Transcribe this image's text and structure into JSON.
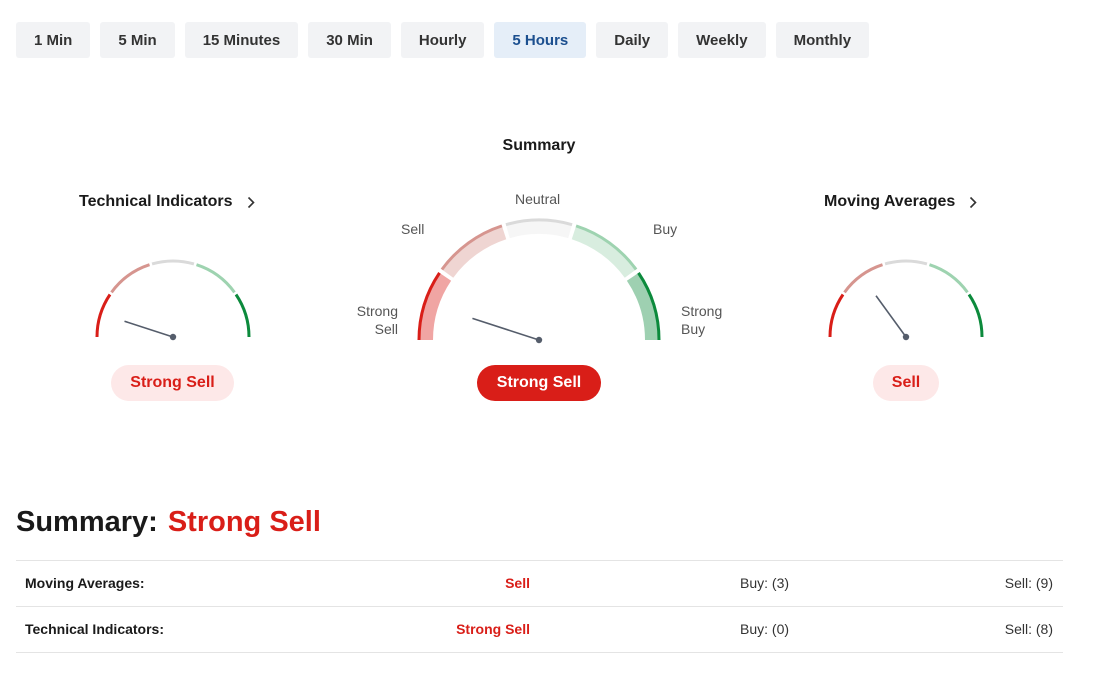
{
  "tabs": [
    {
      "label": "1 Min",
      "active": false
    },
    {
      "label": "5 Min",
      "active": false
    },
    {
      "label": "15 Minutes",
      "active": false
    },
    {
      "label": "30 Min",
      "active": false
    },
    {
      "label": "Hourly",
      "active": false
    },
    {
      "label": "5 Hours",
      "active": true
    },
    {
      "label": "Daily",
      "active": false
    },
    {
      "label": "Weekly",
      "active": false
    },
    {
      "label": "Monthly",
      "active": false
    }
  ],
  "summary_gauge": {
    "title": "Summary",
    "labels": {
      "strong_sell": "Strong\nSell",
      "sell": "Sell",
      "neutral": "Neutral",
      "buy": "Buy",
      "strong_buy": "Strong\nBuy"
    },
    "result": "Strong Sell",
    "needle_fraction": 0.1
  },
  "technical_indicators_gauge": {
    "title": "Technical Indicators",
    "result": "Strong Sell",
    "needle_fraction": 0.1
  },
  "moving_averages_gauge": {
    "title": "Moving Averages",
    "result": "Sell",
    "needle_fraction": 0.3
  },
  "summary": {
    "label": "Summary:",
    "value": "Strong Sell"
  },
  "table": [
    {
      "name": "Moving Averages:",
      "signal": "Sell",
      "buy": "Buy: (3)",
      "sell": "Sell: (9)"
    },
    {
      "name": "Technical Indicators:",
      "signal": "Strong Sell",
      "buy": "Buy: (0)",
      "sell": "Sell: (8)"
    }
  ],
  "colors": {
    "strong_sell": "#d91e18",
    "sell": "#d6958f",
    "neutral": "#dadada",
    "buy": "#9ed3b0",
    "strong_buy": "#0c8a3c",
    "active_tab_bg": "#e5eef8",
    "active_tab_text": "#1b4f8f"
  },
  "icons": {
    "chevron": "chevron-right-icon"
  }
}
